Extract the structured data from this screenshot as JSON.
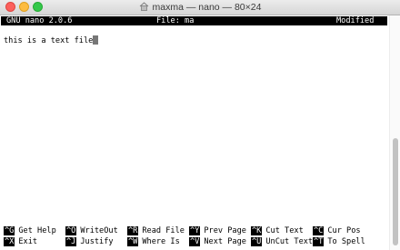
{
  "window": {
    "title": "maxma — nano — 80×24",
    "controls": [
      "close",
      "minimize",
      "zoom"
    ]
  },
  "nano": {
    "header": {
      "version": "GNU nano 2.0.6",
      "file": "File: ma",
      "status": "Modified"
    },
    "content": "this is a text file",
    "shortcuts_row1": [
      {
        "key": "^G",
        "label": "Get Help"
      },
      {
        "key": "^O",
        "label": "WriteOut"
      },
      {
        "key": "^R",
        "label": "Read File"
      },
      {
        "key": "^Y",
        "label": "Prev Page"
      },
      {
        "key": "^K",
        "label": "Cut Text"
      },
      {
        "key": "^C",
        "label": "Cur Pos"
      }
    ],
    "shortcuts_row2": [
      {
        "key": "^X",
        "label": "Exit"
      },
      {
        "key": "^J",
        "label": "Justify"
      },
      {
        "key": "^W",
        "label": "Where Is"
      },
      {
        "key": "^V",
        "label": "Next Page"
      },
      {
        "key": "^U",
        "label": "UnCut Text"
      },
      {
        "key": "^T",
        "label": "To Spell"
      }
    ]
  },
  "colors": {
    "close": "#fc605c",
    "minimize": "#fdbc40",
    "zoom": "#34c84a",
    "bar_bg": "#000000",
    "bar_fg": "#ffffff"
  }
}
